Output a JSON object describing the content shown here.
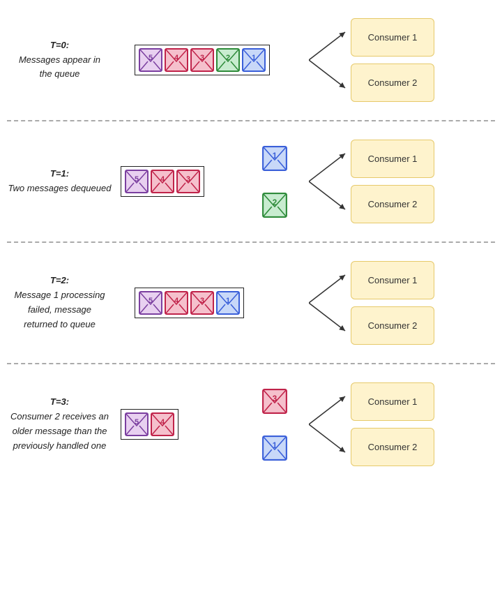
{
  "sections": [
    {
      "id": "t0",
      "time_label": "T=0:",
      "description": "Messages appear in\nthe queue",
      "queue_messages": [
        {
          "num": 5,
          "color": "purple"
        },
        {
          "num": 4,
          "color": "crimson"
        },
        {
          "num": 3,
          "color": "crimson"
        },
        {
          "num": 2,
          "color": "green"
        },
        {
          "num": 1,
          "color": "blue"
        }
      ],
      "floating_msgs": [],
      "consumers": [
        "Consumer 1",
        "Consumer 2"
      ],
      "lines": "normal"
    },
    {
      "id": "t1",
      "time_label": "T=1:",
      "description": "Two messages dequeued",
      "queue_messages": [
        {
          "num": 5,
          "color": "purple"
        },
        {
          "num": 4,
          "color": "crimson"
        },
        {
          "num": 3,
          "color": "crimson"
        }
      ],
      "floating_msgs": [
        {
          "num": 1,
          "color": "blue",
          "consumer": 0
        },
        {
          "num": 2,
          "color": "green",
          "consumer": 1
        }
      ],
      "consumers": [
        "Consumer 1",
        "Consumer 2"
      ],
      "lines": "from_floating"
    },
    {
      "id": "t2",
      "time_label": "T=2:",
      "description": "Message 1 processing\nfailed, message\nreturned to queue",
      "queue_messages": [
        {
          "num": 5,
          "color": "purple"
        },
        {
          "num": 4,
          "color": "crimson"
        },
        {
          "num": 3,
          "color": "crimson"
        },
        {
          "num": 1,
          "color": "blue"
        }
      ],
      "floating_msgs": [],
      "consumers": [
        "Consumer 1",
        "Consumer 2"
      ],
      "lines": "normal"
    },
    {
      "id": "t3",
      "time_label": "T=3:",
      "description": "Consumer 2 receives an\nolder message than the\npreviously handled one",
      "queue_messages": [
        {
          "num": 5,
          "color": "purple"
        },
        {
          "num": 4,
          "color": "crimson"
        }
      ],
      "floating_msgs": [
        {
          "num": 3,
          "color": "crimson",
          "consumer": 0
        },
        {
          "num": 1,
          "color": "blue",
          "consumer": 1
        }
      ],
      "consumers": [
        "Consumer 1",
        "Consumer 2"
      ],
      "lines": "from_floating"
    }
  ],
  "colors": {
    "blue": "#3a5fd9",
    "crimson": "#c0234a",
    "purple": "#7b3fa0",
    "green": "#2e8b3a",
    "consumer_bg": "#fef3cd",
    "consumer_border": "#e6c96a"
  }
}
